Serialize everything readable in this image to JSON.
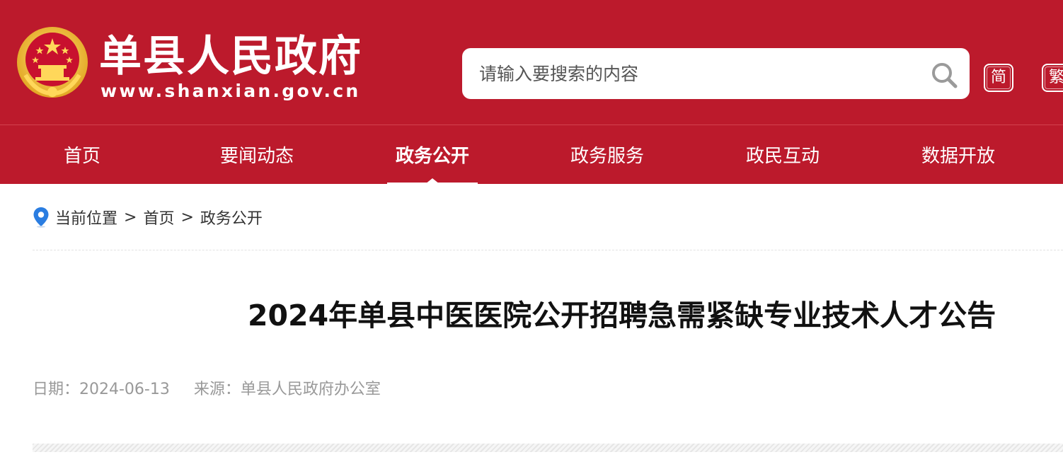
{
  "header": {
    "site_title": "单县人民政府",
    "site_domain": "www.shanxian.gov.cn",
    "brand_color": "#bc1a2c"
  },
  "search": {
    "placeholder": "请输入要搜索的内容",
    "value": ""
  },
  "language": {
    "simplified": "简",
    "traditional": "繁"
  },
  "nav": {
    "items": [
      {
        "label": "首页",
        "active": false
      },
      {
        "label": "要闻动态",
        "active": false
      },
      {
        "label": "政务公开",
        "active": true
      },
      {
        "label": "政务服务",
        "active": false
      },
      {
        "label": "政民互动",
        "active": false
      },
      {
        "label": "数据开放",
        "active": false
      }
    ]
  },
  "breadcrumb": {
    "prefix": "当前位置",
    "items": [
      "首页",
      "政务公开"
    ],
    "separator": ">"
  },
  "article": {
    "title": "2024年单县中医医院公开招聘急需紧缺专业技术人才公告",
    "date_label": "日期：2024-06-13",
    "source_label": "来源：单县人民政府办公室"
  },
  "icons": {
    "emblem": "national-emblem-icon",
    "search": "search-icon",
    "location": "location-pin-icon"
  }
}
